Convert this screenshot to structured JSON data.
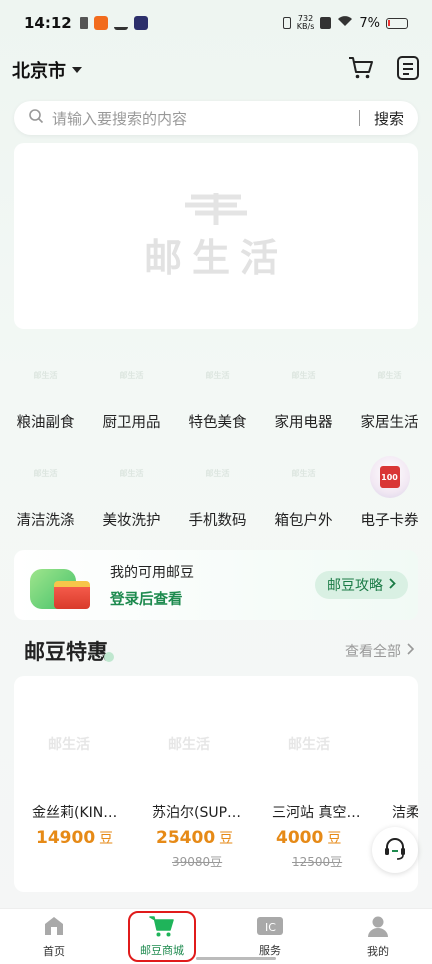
{
  "status": {
    "time": "14:12",
    "speed_top": "732",
    "speed_bottom": "KB/s",
    "battery": "7%"
  },
  "header": {
    "city": "北京市",
    "icons": [
      "cart-icon",
      "orders-icon"
    ]
  },
  "search": {
    "placeholder": "请输入要搜索的内容",
    "button": "搜索"
  },
  "banner": {
    "logo": "邮生活"
  },
  "categories": [
    {
      "label": "粮油副食",
      "icon": "grain-oil-icon"
    },
    {
      "label": "厨卫用品",
      "icon": "kitchen-icon"
    },
    {
      "label": "特色美食",
      "icon": "food-icon"
    },
    {
      "label": "家用电器",
      "icon": "appliance-icon"
    },
    {
      "label": "家居生活",
      "icon": "home-life-icon"
    },
    {
      "label": "清洁洗涤",
      "icon": "cleaning-icon"
    },
    {
      "label": "美妆洗护",
      "icon": "beauty-icon"
    },
    {
      "label": "手机数码",
      "icon": "phone-icon"
    },
    {
      "label": "箱包户外",
      "icon": "luggage-icon"
    },
    {
      "label": "电子卡券",
      "icon": "coupon-icon",
      "badge": "100"
    }
  ],
  "points": {
    "title": "我的可用邮豆",
    "login": "登录后查看",
    "guide": "邮豆攻略"
  },
  "section": {
    "title": "邮豆特惠",
    "more": "查看全部"
  },
  "products": [
    {
      "name": "金丝莉(KIN…",
      "price": "14900",
      "unit": "豆",
      "old": ""
    },
    {
      "name": "苏泊尔(SUP…",
      "price": "25400",
      "unit": "豆",
      "old": "39080豆"
    },
    {
      "name": "三河站 真空…",
      "price": "4000",
      "unit": "豆",
      "old": "12500豆"
    },
    {
      "name": "洁柔",
      "price": "",
      "unit": "",
      "old": ""
    }
  ],
  "tabs": [
    {
      "label": "首页",
      "icon": "home-icon"
    },
    {
      "label": "邮豆商城",
      "icon": "shop-cart-icon",
      "active": true
    },
    {
      "label": "服务",
      "icon": "service-icon"
    },
    {
      "label": "我的",
      "icon": "profile-icon"
    }
  ],
  "colors": {
    "accent": "#1d8a4e",
    "price": "#e68a17",
    "highlight_box": "#e01b1b"
  }
}
